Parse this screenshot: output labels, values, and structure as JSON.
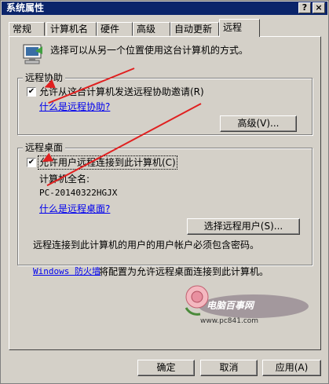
{
  "window": {
    "title": "系统属性",
    "help_btn": "?",
    "close_btn": "×"
  },
  "tabs": [
    "常规",
    "计算机名",
    "硬件",
    "高级",
    "自动更新",
    "远程"
  ],
  "active_tab": "远程",
  "intro_text": "选择可以从另一个位置使用这台计算机的方式。",
  "remote_assistance": {
    "group_label": "远程协助",
    "checkbox_label": "允许从这台计算机发送远程协助邀请(R)",
    "checked": true,
    "link": "什么是远程协助?",
    "advanced_button": "高级(V)..."
  },
  "remote_desktop": {
    "group_label": "远程桌面",
    "checkbox_label": "允许用户远程连接到此计算机(C)",
    "checked": true,
    "fullname_label": "计算机全名:",
    "computer_name": "PC-20140322HGJX",
    "link": "什么是远程桌面?",
    "select_users_button": "选择远程用户(S)...",
    "password_note": "远程连接到此计算机的用户的用户帐户必须包含密码。",
    "firewall_link": "Windows 防火墙",
    "firewall_text": "将配置为允许远程桌面连接到此计算机。"
  },
  "watermark": {
    "text": "电脑百事网",
    "url": "www.pc841.com"
  },
  "footer_buttons": {
    "ok": "确定",
    "cancel": "取消",
    "apply": "应用(A)"
  },
  "colors": {
    "title_bg": "#0a246a",
    "face": "#d4d0c8",
    "link": "#0000ee",
    "arrow": "#e02020"
  }
}
